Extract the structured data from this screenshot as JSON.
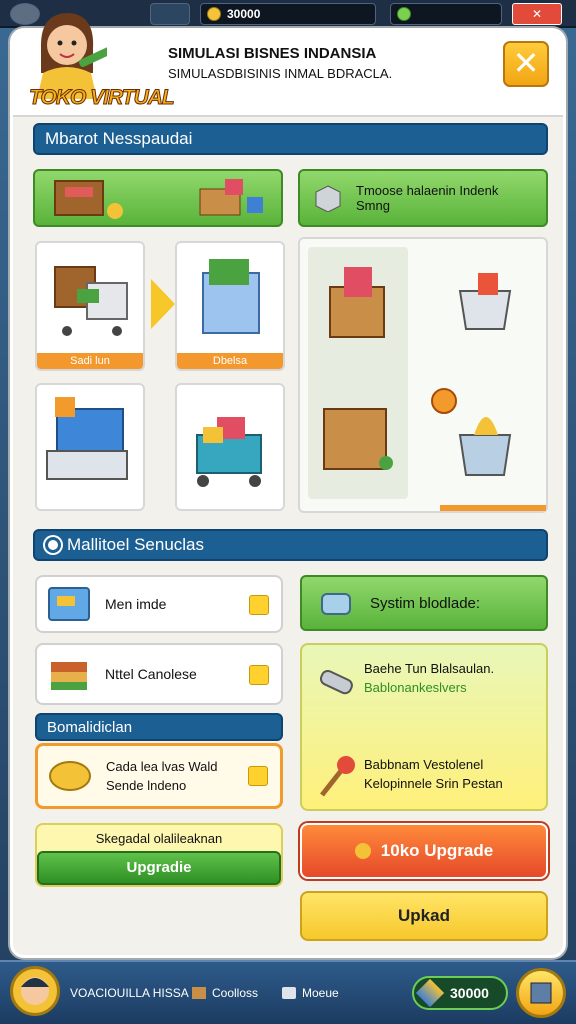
{
  "topbar": {
    "score": "30000"
  },
  "header": {
    "logo": "TOKO VIRTUAL",
    "title": "SIMULASI BISNES INDANSIA",
    "subtitle": "SIMULASDBISINIS INMAL BDRACLA.",
    "close_icon": "close-icon"
  },
  "section1": {
    "title": "Mbarot Nesspaudai"
  },
  "section1_right_bar": {
    "text": "Tmoose halaenin Indenk Smng"
  },
  "grid_cards": [
    {
      "label": "Sadi lun"
    },
    {
      "label": "Dbelsa"
    }
  ],
  "section2": {
    "title": "Mallitoel Senuclas"
  },
  "list_items": [
    {
      "label": "Men imde"
    },
    {
      "label": "Nttel Canolese"
    }
  ],
  "right_green": {
    "label": "Systim blodlade:"
  },
  "right_info": [
    {
      "line1": "Baehe Tun Blalsaulan.",
      "line2": "Bablonankeslvers"
    },
    {
      "line1": "Babbnam Vestolenel",
      "line2": "Kelopinnele Srin Pestan"
    }
  ],
  "subsection": {
    "title": "Bomalidiclan"
  },
  "offer": {
    "line1": "Cada lea lvas Wald",
    "line2": "Sende lndeno"
  },
  "upgrade_box": {
    "caption": "Skegadal olalileaknan",
    "button": "Upgradie"
  },
  "toko_upgrade": {
    "label": "10ko Upgrade"
  },
  "upkad": {
    "label": "Upkad"
  },
  "bottombar": {
    "item1": "VOACIOUILLA HISSA",
    "item2": "Coolloss",
    "item3": "Moeue",
    "gems": "30000"
  }
}
